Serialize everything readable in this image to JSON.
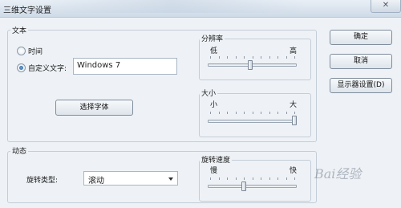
{
  "window": {
    "title": "三维文字设置",
    "close_glyph": "✕"
  },
  "text_group": {
    "label": "文本",
    "time_radio_label": "时间",
    "custom_text_radio_label": "自定义文字:",
    "custom_text_value": "Windows 7",
    "selected": "custom",
    "choose_font_label": "选择字体"
  },
  "resolution": {
    "label": "分辨率",
    "low": "低",
    "high": "高",
    "level": 0.48
  },
  "size": {
    "label": "大小",
    "small": "小",
    "large": "大",
    "level": 1.0
  },
  "motion_group": {
    "label": "动态",
    "rotation_type_label": "旋转类型:",
    "rotation_type_value": "滚动"
  },
  "rotation_speed": {
    "label": "旋转速度",
    "slow": "慢",
    "fast": "快",
    "level": 0.4
  },
  "buttons": {
    "ok": "确定",
    "cancel": "取消",
    "display_settings": "显示器设置(D)"
  },
  "watermark": {
    "text": "Bai经验"
  }
}
